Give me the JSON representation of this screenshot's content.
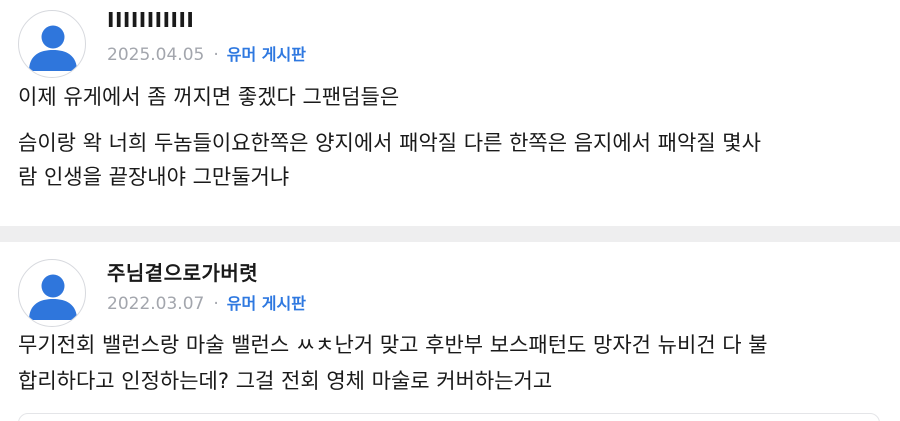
{
  "posts": [
    {
      "author": "IIIIIIIIIII",
      "date": "2025.04.05",
      "separator": "·",
      "board": "유머 게시판",
      "lines": [
        "이제 유게에서 좀 꺼지면 좋겠다 그팬덤들은",
        "슴이랑 왁 너희 두놈들이요한쪽은 양지에서 패악질 다른 한쪽은 음지에서 패악질 몇사",
        "람 인생을 끝장내야 그만둘거냐"
      ]
    },
    {
      "author": "주님곁으로가버렷",
      "date": "2022.03.07",
      "separator": "·",
      "board": "유머 게시판",
      "lines": [
        "무기전회 밸런스랑 마술 밸런스 ㅆㅊ난거 맞고 후반부 보스패턴도 망자건 뉴비건 다 불",
        "합리하다고 인정하는데? 그걸 전회 영체 마술로 커버하는거고"
      ]
    }
  ],
  "colors": {
    "accent_board": "#2e78e0",
    "meta_gray": "#a3a6ad",
    "avatar_blue": "#2f76dc",
    "separator": "#eeeeef"
  }
}
